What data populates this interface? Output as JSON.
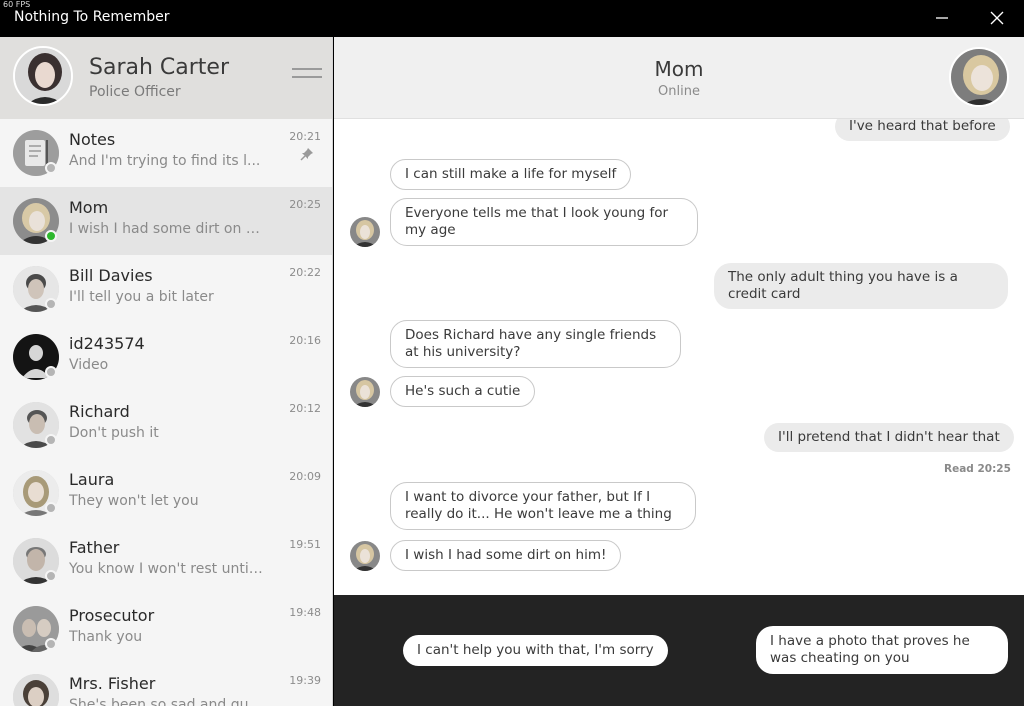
{
  "window": {
    "fps": "60 FPS",
    "title": "Nothing To Remember"
  },
  "profile": {
    "name": "Sarah Carter",
    "role": "Police Officer"
  },
  "chats": [
    {
      "name": "Notes",
      "preview": "And I'm trying to find its l...",
      "time": "20:21",
      "status": "offline",
      "pinned": true
    },
    {
      "name": "Mom",
      "preview": "I wish I had some dirt on him!",
      "time": "20:25",
      "status": "online",
      "active": true
    },
    {
      "name": "Bill Davies",
      "preview": "I'll tell you a bit later",
      "time": "20:22",
      "status": "offline"
    },
    {
      "name": "id243574",
      "preview": "Video",
      "time": "20:16",
      "status": "offline"
    },
    {
      "name": "Richard",
      "preview": "Don't push it",
      "time": "20:12",
      "status": "offline"
    },
    {
      "name": "Laura",
      "preview": "They won't let you",
      "time": "20:09",
      "status": "offline"
    },
    {
      "name": "Father",
      "preview": "You know I won't rest until...",
      "time": "19:51",
      "status": "offline"
    },
    {
      "name": "Prosecutor",
      "preview": "Thank you",
      "time": "19:48",
      "status": "offline"
    },
    {
      "name": "Mrs. Fisher",
      "preview": "She's been so sad and quie...",
      "time": "19:39",
      "status": "offline"
    }
  ],
  "conversation": {
    "name": "Mom",
    "status": "Online",
    "messages": [
      {
        "text": "I've heard that before",
        "dir": "out"
      },
      {
        "text": "I can still make a life for myself",
        "dir": "in"
      },
      {
        "text": "Everyone tells me that I look young for my age",
        "dir": "in"
      },
      {
        "text": "The only adult thing you have is a credit card",
        "dir": "out"
      },
      {
        "text": "Does Richard have any single friends at his university?",
        "dir": "in"
      },
      {
        "text": "He's such a cutie",
        "dir": "in"
      },
      {
        "text": "I'll pretend that I didn't hear that",
        "dir": "out"
      },
      {
        "text": "I want to divorce your father, but If I really do it... He won't leave me a thing",
        "dir": "in"
      },
      {
        "text": "I wish I had some dirt on him!",
        "dir": "in"
      }
    ],
    "read_receipt": "Read 20:25"
  },
  "choices": [
    "I can't help you with that, I'm sorry",
    "I have a photo that proves he was cheating on you"
  ],
  "colors": {
    "online": "#2eb82e",
    "offline": "#b5b5b5",
    "choice_panel": "#232323"
  }
}
